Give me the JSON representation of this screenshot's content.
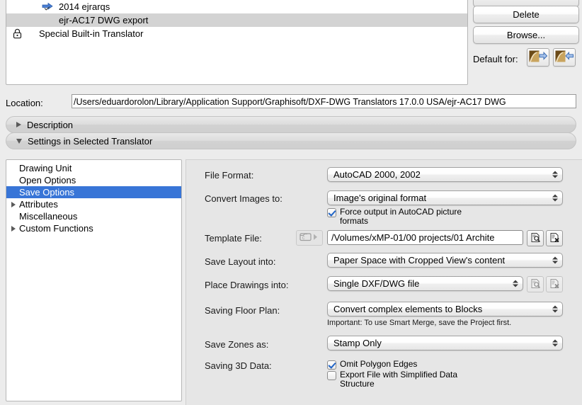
{
  "translator_list": {
    "rows": [
      {
        "icon": "blue-arrow-icon",
        "label": "2014 ejrarqs",
        "indent": 1,
        "selected": false
      },
      {
        "icon": "none",
        "label": "ejr-AC17 DWG export",
        "indent": 2,
        "selected": true
      },
      {
        "icon": "lock-icon",
        "label": "Special Built-in Translator",
        "indent": 1,
        "selected": false
      }
    ]
  },
  "side_buttons": {
    "partial_label": "",
    "delete_label": "Delete",
    "browse_label": "Browse...",
    "default_for_label": "Default for:",
    "default_export_icon": "export-arrow-icon",
    "default_import_icon": "import-arrow-icon"
  },
  "location": {
    "label": "Location:",
    "value": "/Users/eduardorolon/Library/Application Support/Graphisoft/DXF-DWG Translators 17.0.0 USA/ejr-AC17 DWG"
  },
  "disclosure": {
    "description": "Description",
    "settings": "Settings in Selected Translator"
  },
  "tree": {
    "items": [
      {
        "label": "Drawing Unit",
        "expandable": false,
        "selected": false
      },
      {
        "label": "Open Options",
        "expandable": false,
        "selected": false
      },
      {
        "label": "Save Options",
        "expandable": false,
        "selected": true
      },
      {
        "label": "Attributes",
        "expandable": true,
        "selected": false
      },
      {
        "label": "Miscellaneous",
        "expandable": false,
        "selected": false
      },
      {
        "label": "Custom Functions",
        "expandable": true,
        "selected": false
      }
    ]
  },
  "form": {
    "file_format": {
      "label": "File Format:",
      "value": "AutoCAD 2000, 2002"
    },
    "convert_images": {
      "label": "Convert Images to:",
      "value": "Image's original format",
      "force_output_checkbox": {
        "label": "Force output in AutoCAD picture formats",
        "checked": true
      }
    },
    "template_file": {
      "label": "Template File:",
      "value": "/Volumes/xMP-01/00 projects/01 Archite",
      "pre_icon": "folder-arrow-icon",
      "browse_icon": "document-search-icon",
      "clear_icon": "document-delete-icon"
    },
    "save_layout": {
      "label": "Save Layout into:",
      "value": "Paper Space with Cropped View's content"
    },
    "place_drawings": {
      "label": "Place Drawings into:",
      "value": "Single DXF/DWG file",
      "browse_icon": "document-search-icon",
      "clear_icon": "document-delete-icon"
    },
    "saving_floor_plan": {
      "label": "Saving Floor Plan:",
      "value": "Convert complex elements to Blocks",
      "hint": "Important: To use Smart Merge, save the Project first."
    },
    "save_zones": {
      "label": "Save Zones as:",
      "value": "Stamp Only"
    },
    "saving_3d": {
      "label": "Saving 3D Data:",
      "omit_polygon_edges": {
        "label": "Omit Polygon Edges",
        "checked": true
      },
      "simplified_data": {
        "label": "Export File with Simplified Data Structure",
        "checked": false
      }
    }
  },
  "colors": {
    "selection_blue": "#3875d7",
    "list_selection_grey": "#d3d3d3",
    "window_bg": "#ececec"
  }
}
